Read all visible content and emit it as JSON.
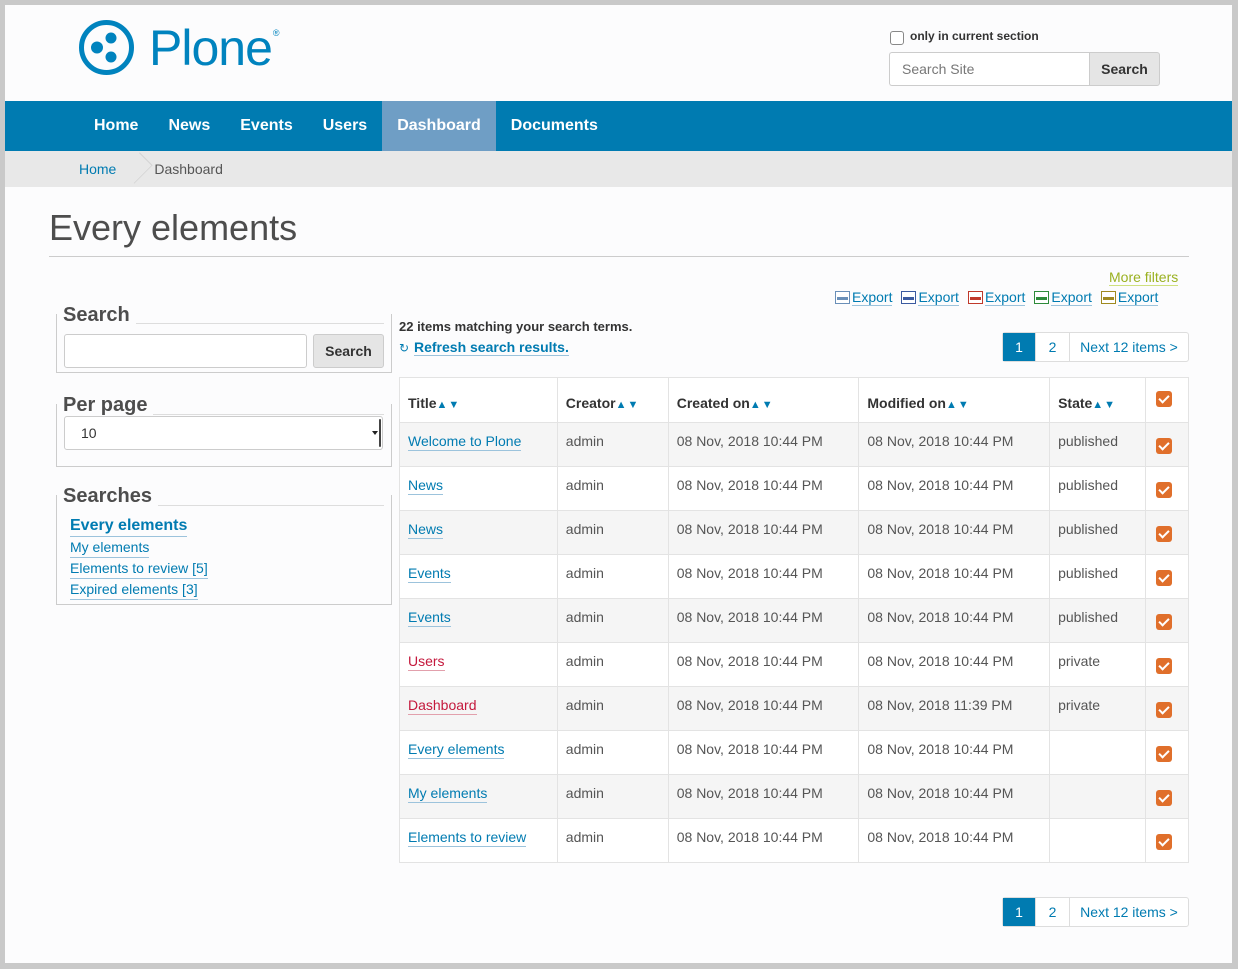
{
  "header": {
    "logo_text": "Plone",
    "logo_mark": "®",
    "only_current_section_label": "only in current section",
    "search_placeholder": "Search Site",
    "search_button": "Search"
  },
  "nav": {
    "items": [
      {
        "label": "Home",
        "active": false
      },
      {
        "label": "News",
        "active": false
      },
      {
        "label": "Events",
        "active": false
      },
      {
        "label": "Users",
        "active": false
      },
      {
        "label": "Dashboard",
        "active": true
      },
      {
        "label": "Documents",
        "active": false
      }
    ]
  },
  "breadcrumb": {
    "home": "Home",
    "current": "Dashboard"
  },
  "page": {
    "title": "Every elements"
  },
  "sidebar": {
    "search_heading": "Search",
    "search_input_value": "",
    "search_button": "Search",
    "per_page_heading": "Per page",
    "per_page_value": "10",
    "searches_heading": "Searches",
    "saved_searches": [
      {
        "label": "Every elements",
        "current": true
      },
      {
        "label": "My elements",
        "current": false
      },
      {
        "label": "Elements to review [5]",
        "current": false
      },
      {
        "label": "Expired elements [3]",
        "current": false
      }
    ]
  },
  "main": {
    "more_filters": "More filters",
    "exports": [
      {
        "label": "Export",
        "icon": "csv-export-icon"
      },
      {
        "label": "Export",
        "icon": "doc-export-icon"
      },
      {
        "label": "Export",
        "icon": "pdf-export-icon"
      },
      {
        "label": "Export",
        "icon": "xls-export-icon"
      },
      {
        "label": "Export",
        "icon": "ods-export-icon"
      }
    ],
    "result_count": "22 items matching your search terms.",
    "refresh_label": "Refresh search results.",
    "pager": {
      "current": "1",
      "page2": "2",
      "next": "Next 12 items >"
    },
    "columns": [
      "Title",
      "Creator",
      "Created on",
      "Modified on",
      "State"
    ],
    "sort_arrows": "▲▼",
    "rows": [
      {
        "title": "Welcome to Plone",
        "creator": "admin",
        "created": "08 Nov, 2018 10:44 PM",
        "modified": "08 Nov, 2018 10:44 PM",
        "state": "published",
        "kind": "pub"
      },
      {
        "title": "News",
        "creator": "admin",
        "created": "08 Nov, 2018 10:44 PM",
        "modified": "08 Nov, 2018 10:44 PM",
        "state": "published",
        "kind": "pub"
      },
      {
        "title": "News",
        "creator": "admin",
        "created": "08 Nov, 2018 10:44 PM",
        "modified": "08 Nov, 2018 10:44 PM",
        "state": "published",
        "kind": "pub"
      },
      {
        "title": "Events",
        "creator": "admin",
        "created": "08 Nov, 2018 10:44 PM",
        "modified": "08 Nov, 2018 10:44 PM",
        "state": "published",
        "kind": "pub"
      },
      {
        "title": "Events",
        "creator": "admin",
        "created": "08 Nov, 2018 10:44 PM",
        "modified": "08 Nov, 2018 10:44 PM",
        "state": "published",
        "kind": "pub"
      },
      {
        "title": "Users",
        "creator": "admin",
        "created": "08 Nov, 2018 10:44 PM",
        "modified": "08 Nov, 2018 10:44 PM",
        "state": "private",
        "kind": "priv"
      },
      {
        "title": "Dashboard",
        "creator": "admin",
        "created": "08 Nov, 2018 10:44 PM",
        "modified": "08 Nov, 2018 11:39 PM",
        "state": "private",
        "kind": "priv"
      },
      {
        "title": "Every elements",
        "creator": "admin",
        "created": "08 Nov, 2018 10:44 PM",
        "modified": "08 Nov, 2018 10:44 PM",
        "state": "",
        "kind": "none"
      },
      {
        "title": "My elements",
        "creator": "admin",
        "created": "08 Nov, 2018 10:44 PM",
        "modified": "08 Nov, 2018 10:44 PM",
        "state": "",
        "kind": "none"
      },
      {
        "title": "Elements to review",
        "creator": "admin",
        "created": "08 Nov, 2018 10:44 PM",
        "modified": "08 Nov, 2018 10:44 PM",
        "state": "",
        "kind": "none"
      }
    ]
  },
  "colors": {
    "brand_blue": "#007bb1",
    "nav_active": "#6f9ec5",
    "private_red": "#c4183c",
    "more_filters_green": "#9ab120",
    "checkbox_orange": "#e06f2b"
  }
}
